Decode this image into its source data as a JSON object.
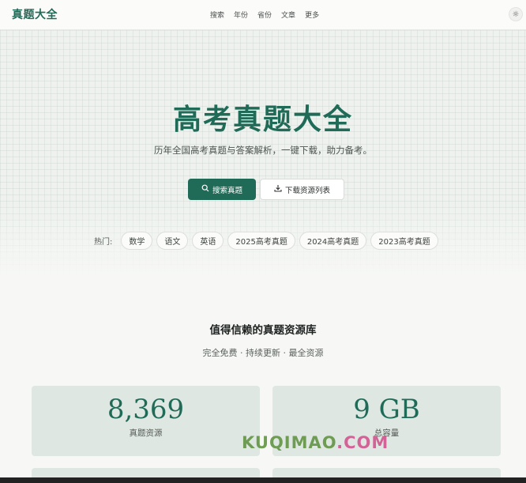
{
  "header": {
    "logo": "真题大全",
    "nav": [
      "搜索",
      "年份",
      "省份",
      "文章",
      "更多"
    ],
    "theme_icon": "sun-icon"
  },
  "hero": {
    "title": "高考真题大全",
    "subtitle": "历年全国高考真题与答案解析，一键下载，助力备考。",
    "primary_button": "搜索真题",
    "secondary_button": "下载资源列表",
    "hot_label": "热门:",
    "hot_tags": [
      "数学",
      "语文",
      "英语",
      "2025高考真题",
      "2024高考真题",
      "2023高考真题"
    ]
  },
  "trust": {
    "title": "值得信赖的真题资源库",
    "subtitle": "完全免费 · 持续更新 · 最全资源",
    "stats": [
      {
        "value": "8,369",
        "label": "真题资源"
      },
      {
        "value": "9 GB",
        "label": "总容量"
      }
    ]
  },
  "watermark": {
    "text_a": "KUQIMAO",
    "text_b": ".COM"
  },
  "colors": {
    "accent": "#1f6b57",
    "card": "#dfe7e2",
    "background": "#f7f8f6"
  }
}
